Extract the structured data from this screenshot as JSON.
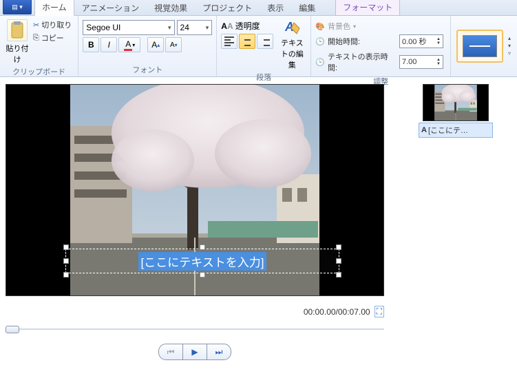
{
  "tabs": {
    "home": "ホーム",
    "animation": "アニメーション",
    "visual": "視覚効果",
    "project": "プロジェクト",
    "view": "表示",
    "edit": "編集",
    "format": "フォーマット"
  },
  "clipboard": {
    "paste": "貼り付け",
    "cut": "切り取り",
    "copy": "コピー",
    "group": "クリップボード"
  },
  "font": {
    "family": "Segoe UI",
    "size": "24",
    "group": "フォント"
  },
  "paragraph": {
    "transparency": "透明度",
    "textedit": "テキストの編集",
    "group": "段落"
  },
  "adjust": {
    "bgcolor": "背景色",
    "start": "開始時間:",
    "duration": "テキストの表示時間:",
    "start_val": "0.00 秒",
    "duration_val": "7.00",
    "group": "調整"
  },
  "stage": {
    "placeholder": "[ここにテキストを入力]",
    "time": "00:00.00/00:07.00"
  },
  "side": {
    "caption": "[ここにテ…"
  }
}
